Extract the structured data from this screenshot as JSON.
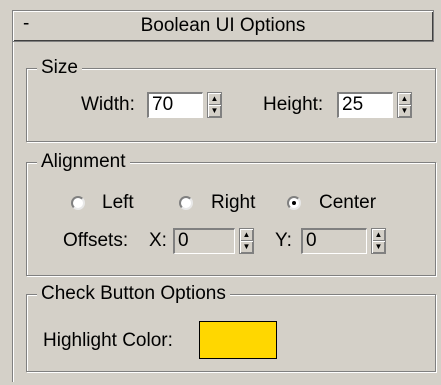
{
  "rollout": {
    "title": "Boolean UI Options",
    "collapse_symbol": "-"
  },
  "size_group": {
    "legend": "Size",
    "width_label": "Width:",
    "width_value": "70",
    "height_label": "Height:",
    "height_value": "25"
  },
  "alignment_group": {
    "legend": "Alignment",
    "left_label": "Left",
    "right_label": "Right",
    "center_label": "Center",
    "selected": "Center",
    "offsets_label": "Offsets:",
    "x_label": "X:",
    "x_value": "0",
    "y_label": "Y:",
    "y_value": "0"
  },
  "check_group": {
    "legend": "Check Button Options",
    "highlight_label": "Highlight Color:",
    "highlight_color": "#ffd700"
  },
  "icons": {
    "spinner_up": "▲",
    "spinner_down": "▼"
  }
}
